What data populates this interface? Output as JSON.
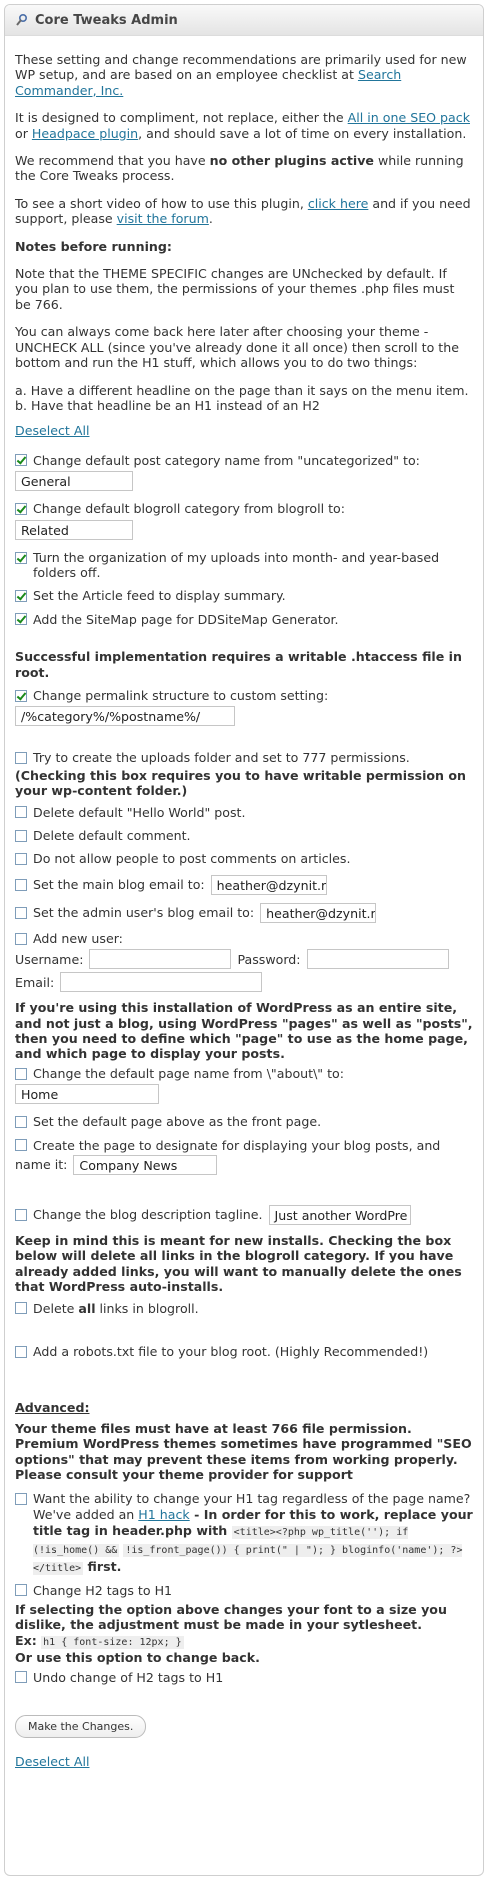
{
  "title": "Core Tweaks Admin",
  "intro": {
    "p1_a": "These setting and change recommendations are primarily used for new WP setup, and are based on an employee checklist at ",
    "p1_link": "Search Commander, Inc.",
    "p2_a": "It is designed to compliment, not replace, either the ",
    "p2_link1": "All in one SEO pack",
    "p2_b": " or ",
    "p2_link2": "Headpace plugin",
    "p2_c": ", and should save a lot of time on every installation.",
    "p3_a": "We recommend that you have ",
    "p3_bold": "no other plugins active",
    "p3_b": " while running the Core Tweaks process.",
    "p4_a": "To see a short video of how to use this plugin, ",
    "p4_link1": "click here",
    "p4_b": " and if you need support, please ",
    "p4_link2": "visit the forum",
    "p4_c": ".",
    "notes_heading": "Notes before running:",
    "p5": "Note that the THEME SPECIFIC changes are UNchecked by default. If you plan to use them, the permissions of your themes .php files must be 766.",
    "p6": "You can always come back here later after choosing your theme - UNCHECK ALL (since you've already done it all once) then scroll to the bottom and run the H1 stuff, which allows you to do two things:",
    "p7a": "a. Have a different headline on the page than it says on the menu item.",
    "p7b": "b. Have that headline be an H1 instead of an H2"
  },
  "deselect_all": "Deselect All",
  "options": {
    "cat_label": "Change default post category name from \"uncategorized\" to:",
    "cat_value": "General",
    "blogroll_label": "Change default blogroll category from blogroll to:",
    "blogroll_value": "Related",
    "uploads_org": "Turn the organization of my uploads into month- and year-based folders off.",
    "article_feed": "Set the Article feed to display summary.",
    "sitemap": "Add the SiteMap page for DDSiteMap Generator.",
    "htaccess_note": "Successful implementation requires a writable .htaccess file in root.",
    "permalink_label": "Change permalink structure to custom setting:",
    "permalink_value": "/%category%/%postname%/",
    "uploads_folder": "Try to create the uploads folder and set to 777 permissions.",
    "uploads_note": "(Checking this box requires you to have writable permission on your wp-content folder.)",
    "delete_post": "Delete default \"Hello World\" post.",
    "delete_comment": "Delete default comment.",
    "no_comments": "Do not allow people to post comments on articles.",
    "main_email_label": "Set the main blog email to:",
    "main_email_value": "heather@dzynit.net",
    "admin_email_label": "Set the admin user's blog email to:",
    "admin_email_value": "heather@dzynit.net",
    "new_user": "Add new user:",
    "username_label": "Username:",
    "password_label": "Password:",
    "email_label": "Email:",
    "site_note": "If you're using this installation of WordPress as an entire site, and not just a blog, using WordPress \"pages\" as well as \"posts\", then you need to define which \"page\" to use as the home page, and which page to display your posts.",
    "page_name_label": "Change the default page name from \\\"about\\\" to:",
    "page_name_value": "Home",
    "front_page": "Set the default page above as the front page.",
    "posts_page_label_a": "Create the page to designate for displaying your blog posts, and",
    "posts_page_label_b": "name it:",
    "posts_page_value": "Company News",
    "tagline_label": "Change the blog description tagline.",
    "tagline_value": "Just another WordPre",
    "links_note": "Keep in mind this is meant for new installs. Checking the box below will delete all links in the blogroll category. If you have already added links, you will want to manually delete the ones that WordPress auto-installs.",
    "delete_links_a": "Delete ",
    "delete_links_bold": "all",
    "delete_links_b": " links in blogroll.",
    "robots": "Add a robots.txt file to your blog root. (Highly Recommended!)"
  },
  "advanced": {
    "heading": "Advanced:",
    "note1": "Your theme files must have at least 766 file permission.",
    "note2": "Premium WordPress themes sometimes have programmed \"SEO options\" that may prevent these items from working properly. Please consult your theme provider for support",
    "h1_a": "Want the ability to change your H1 tag regardless of the page name? We've added an ",
    "h1_link": "H1 hack",
    "h1_b": " - In order for this to work, replace your title tag in header.php with ",
    "h1_code1": "<title><?php wp_title(''); if (!is_home() &&",
    "h1_code2": "!is_front_page()) { print(\" | \"); } bloginfo('name'); ?></title>",
    "h1_c": " first.",
    "h2_to_h1": "Change H2 tags to H1",
    "font_note": "If selecting the option above changes your font to a size you dislike, the adjustment must be made in your sytlesheet.",
    "ex_label": "Ex: ",
    "ex_code": "h1 { font-size: 12px; }",
    "or_note": "Or use this option to change back.",
    "undo": "Undo change of H2 tags to H1"
  },
  "submit_label": "Make the Changes.",
  "checkbox_state": {
    "cat": true,
    "blogroll": true,
    "uploads_org": true,
    "article_feed": true,
    "sitemap": true,
    "permalink": true,
    "uploads_folder": false,
    "delete_post": false,
    "delete_comment": false,
    "no_comments": false,
    "main_email": false,
    "admin_email": false,
    "new_user": false,
    "page_name": false,
    "front_page": false,
    "posts_page": false,
    "tagline": false,
    "delete_links": false,
    "robots": false,
    "h1_hack": false,
    "h2_to_h1": false,
    "undo": false
  }
}
